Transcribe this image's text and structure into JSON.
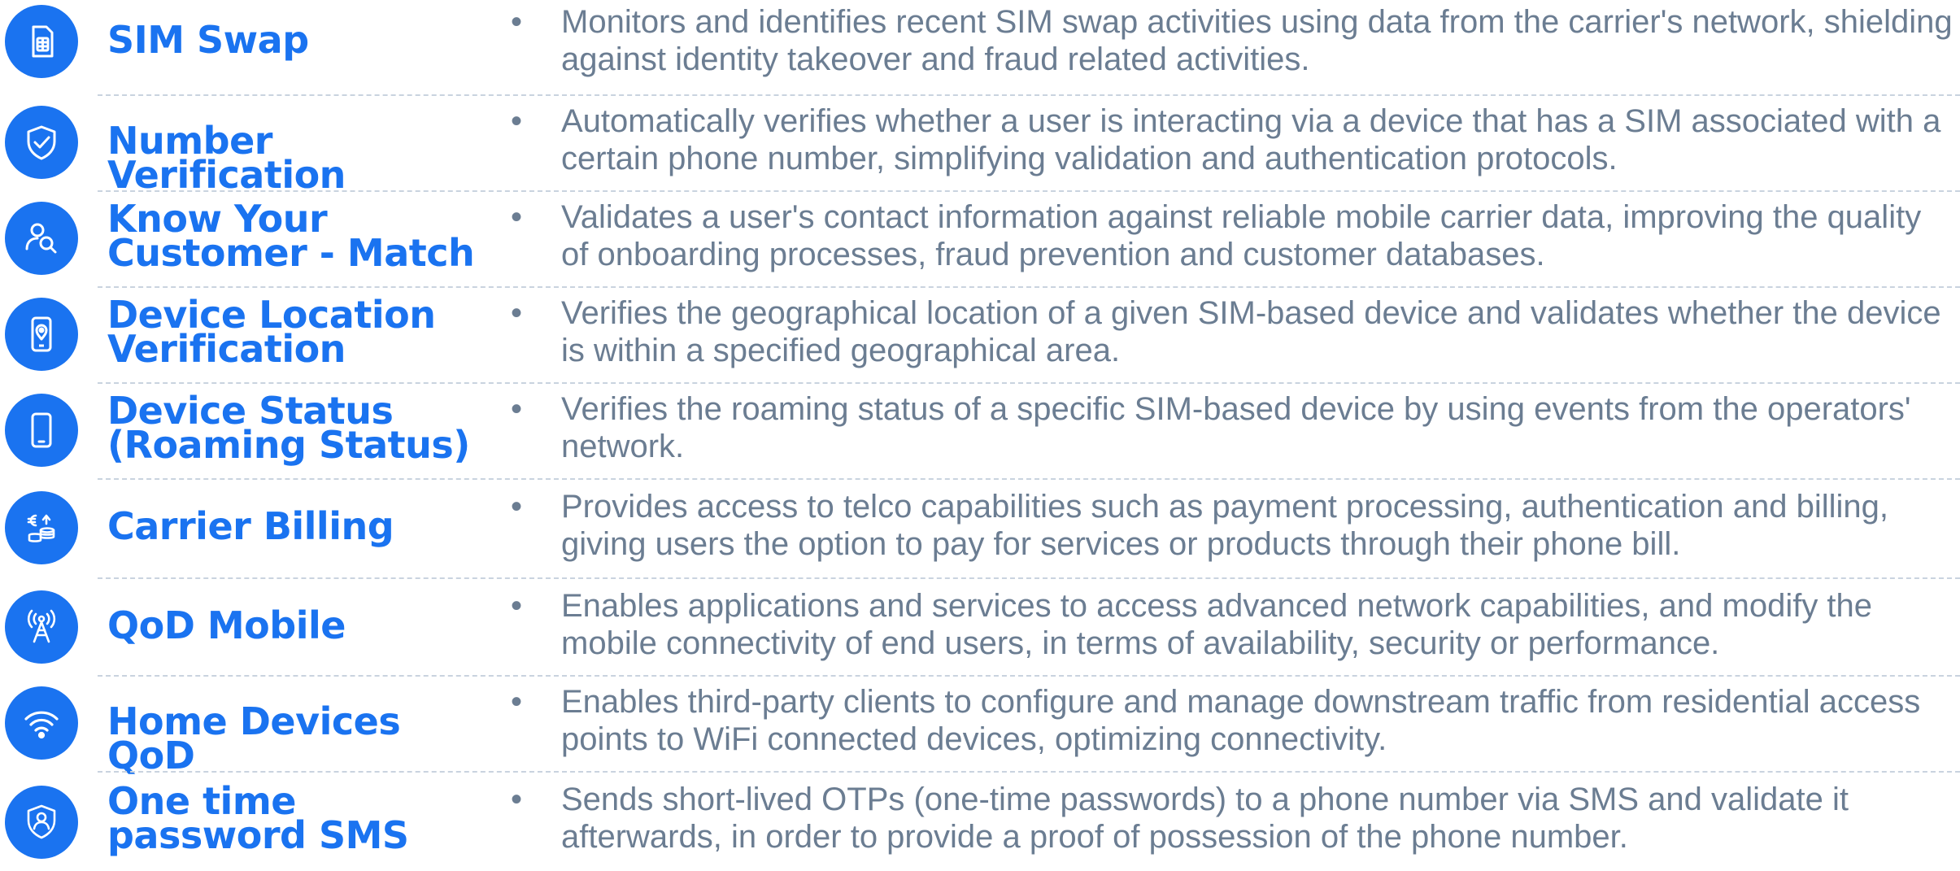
{
  "colors": {
    "accent": "#1a73f0",
    "text": "#6b7d92",
    "separator": "#c9d3df"
  },
  "bullet_glyph": "•",
  "items": [
    {
      "icon": "sim-card-icon",
      "title": "SIM Swap",
      "description": "Monitors and identifies recent SIM swap activities using data from the carrier's network, shielding against identity takeover and fraud related activities."
    },
    {
      "icon": "shield-check-icon",
      "title": "Number Verification",
      "description": "Automatically verifies whether a user is interacting via a device that has a SIM associated with a certain phone number, simplifying validation and authentication protocols."
    },
    {
      "icon": "user-search-icon",
      "title": "Know Your Customer - Match",
      "description": "Validates a user's contact information against reliable mobile carrier data, improving the quality of onboarding processes, fraud prevention and customer databases."
    },
    {
      "icon": "phone-location-icon",
      "title": "Device Location Verification",
      "description": "Verifies the geographical location of a given SIM-based device and validates whether the device is within a specified geographical area."
    },
    {
      "icon": "smartphone-icon",
      "title": "Device Status (Roaming Status)",
      "description": "Verifies the roaming status of a specific SIM-based device by using events from the operators' network."
    },
    {
      "icon": "euro-coins-icon",
      "title": "Carrier Billing",
      "description": "Provides access to telco capabilities such as payment processing, authentication and billing, giving users the option to pay for services or products through their phone bill."
    },
    {
      "icon": "antenna-tower-icon",
      "title": "QoD Mobile",
      "description": "Enables applications and services to access advanced network capabilities, and modify the mobile connectivity of end users, in terms of availability, security or performance."
    },
    {
      "icon": "wifi-icon",
      "title": "Home Devices QoD",
      "description": "Enables third-party clients to configure and manage downstream traffic from residential access points to WiFi connected devices, optimizing connectivity."
    },
    {
      "icon": "shield-user-icon",
      "title": "One time password SMS",
      "description": "Sends short-lived OTPs (one-time passwords) to a phone number via SMS and validate it afterwards, in order to provide a proof of possession of the phone number."
    }
  ]
}
